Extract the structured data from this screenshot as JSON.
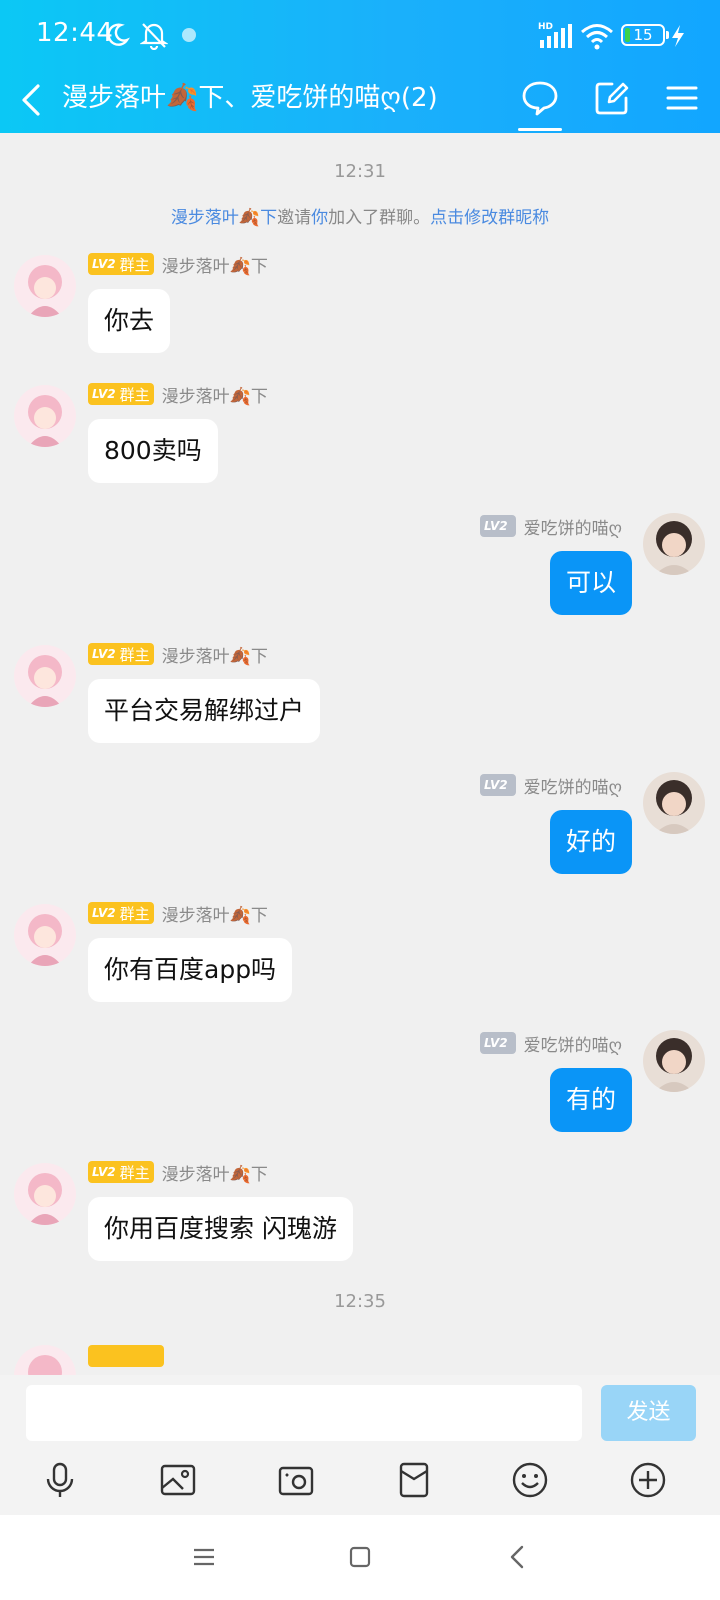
{
  "status_bar": {
    "time": "12:44",
    "battery": "15",
    "signal_label": "HD"
  },
  "header": {
    "title": "漫步落叶🍂下、爱吃饼的喵ღ(2)"
  },
  "chat": {
    "timestamp_1": "12:31",
    "system_notice": {
      "inviter": "漫步落叶🍂下",
      "text1": "邀请",
      "you": "你",
      "text2": "加入了群聊。",
      "action": "点击修改群昵称"
    },
    "messages": [
      {
        "side": "left",
        "level": "LV2",
        "role": "群主",
        "sender": "漫步落叶🍂下",
        "text": "你去"
      },
      {
        "side": "left",
        "level": "LV2",
        "role": "群主",
        "sender": "漫步落叶🍂下",
        "text": "800卖吗"
      },
      {
        "side": "right",
        "level": "LV2",
        "role": "",
        "sender": "爱吃饼的喵ღ",
        "text": "可以"
      },
      {
        "side": "left",
        "level": "LV2",
        "role": "群主",
        "sender": "漫步落叶🍂下",
        "text": "平台交易解绑过户"
      },
      {
        "side": "right",
        "level": "LV2",
        "role": "",
        "sender": "爱吃饼的喵ღ",
        "text": "好的"
      },
      {
        "side": "left",
        "level": "LV2",
        "role": "群主",
        "sender": "漫步落叶🍂下",
        "text": "你有百度app吗"
      },
      {
        "side": "right",
        "level": "LV2",
        "role": "",
        "sender": "爱吃饼的喵ღ",
        "text": "有的"
      },
      {
        "side": "left",
        "level": "LV2",
        "role": "群主",
        "sender": "漫步落叶🍂下",
        "text": "你用百度搜索 闪瑰游"
      }
    ],
    "timestamp_2": "12:35"
  },
  "input": {
    "send_label": "发送",
    "placeholder": ""
  },
  "toolbar_icons": [
    "microphone-icon",
    "image-icon",
    "camera-icon",
    "red-packet-icon",
    "emoji-icon",
    "plus-icon"
  ],
  "colors": {
    "header_gradient_start": "#0bc8f5",
    "header_gradient_end": "#12a6ff",
    "bubble_self": "#0a95f7",
    "owner_badge": "#fbc21f",
    "member_badge": "#b8bec9",
    "send_button": "#99d5f7"
  }
}
